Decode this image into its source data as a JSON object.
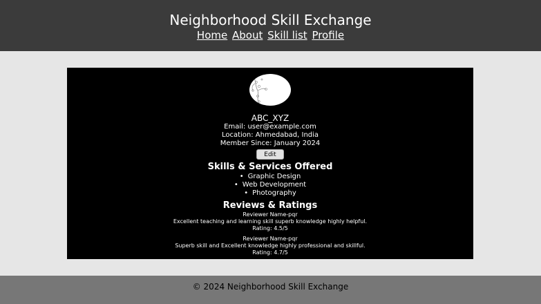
{
  "header": {
    "title": "Neighborhood Skill Exchange",
    "nav": [
      "Home",
      "About",
      "Skill list",
      "Profile"
    ]
  },
  "profile": {
    "avatar_icon": "flower-branch-avatar",
    "username": "ABC_XYZ",
    "email": "Email: user@example.com",
    "location": "Location: Ahmedabad, India",
    "member_since": "Member Since: January 2024",
    "edit_label": "Edit"
  },
  "skills": {
    "title": "Skills & Services Offered",
    "items": [
      "Graphic Design",
      "Web Development",
      "Photography"
    ]
  },
  "reviews": {
    "title": "Reviews & Ratings",
    "items": [
      {
        "reviewer": "Reviewer Name-pqr",
        "text": "Excellent teaching and learning skill superb knowledge highly helpful.",
        "rating": "Rating: 4.5/5"
      },
      {
        "reviewer": "Reviewer Name-pqr",
        "text": "Superb skill and Excellent knowledge highly professional and skillful.",
        "rating": "Rating: 4.7/5"
      }
    ]
  },
  "footer": {
    "text": "© 2024 Neighborhood Skill Exchange"
  }
}
